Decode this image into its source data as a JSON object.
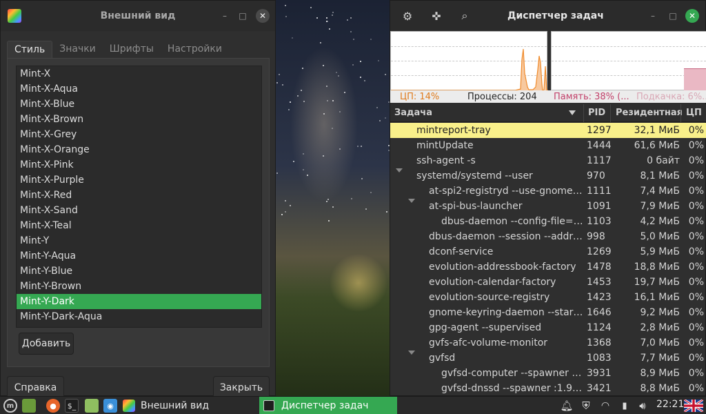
{
  "appearance": {
    "title": "Внешний вид",
    "tabs": [
      {
        "label": "Стиль",
        "active": true
      },
      {
        "label": "Значки",
        "active": false
      },
      {
        "label": "Шрифты",
        "active": false
      },
      {
        "label": "Настройки",
        "active": false
      }
    ],
    "themes": [
      "Mint-X",
      "Mint-X-Aqua",
      "Mint-X-Blue",
      "Mint-X-Brown",
      "Mint-X-Grey",
      "Mint-X-Orange",
      "Mint-X-Pink",
      "Mint-X-Purple",
      "Mint-X-Red",
      "Mint-X-Sand",
      "Mint-X-Teal",
      "Mint-Y",
      "Mint-Y-Aqua",
      "Mint-Y-Blue",
      "Mint-Y-Brown",
      "Mint-Y-Dark",
      "Mint-Y-Dark-Aqua"
    ],
    "selected_theme": "Mint-Y-Dark",
    "add_label": "Добавить",
    "help_label": "Справка",
    "close_label": "Закрыть"
  },
  "taskmgr": {
    "title": "Диспетчер задач",
    "stats": {
      "cpu": "ЦП: 14%",
      "processes": "Процессы: 204",
      "memory": "Память: 38% (...",
      "swap": "Подкачка: 6%..."
    },
    "columns": {
      "task": "Задача",
      "pid": "PID",
      "resident": "Резидентная",
      "cpu": "ЦП"
    },
    "rows": [
      {
        "name": "mintreport-tray",
        "pid": "1297",
        "res": "32,1 МиБ",
        "cpu": "0%",
        "indent": 1,
        "expander": false,
        "highlight": true
      },
      {
        "name": "mintUpdate",
        "pid": "1444",
        "res": "61,6 МиБ",
        "cpu": "0%",
        "indent": 1,
        "expander": false,
        "highlight": false
      },
      {
        "name": "ssh-agent -s",
        "pid": "1117",
        "res": "0 байт",
        "cpu": "0%",
        "indent": 1,
        "expander": false,
        "highlight": false
      },
      {
        "name": "systemd/systemd --user",
        "pid": "970",
        "res": "8,1 МиБ",
        "cpu": "0%",
        "indent": 1,
        "expander": true,
        "highlight": false
      },
      {
        "name": "at-spi2-registryd --use-gnome-se...",
        "pid": "1111",
        "res": "7,4 МиБ",
        "cpu": "0%",
        "indent": 2,
        "expander": false,
        "highlight": false
      },
      {
        "name": "at-spi-bus-launcher",
        "pid": "1091",
        "res": "7,9 МиБ",
        "cpu": "0%",
        "indent": 2,
        "expander": true,
        "highlight": false
      },
      {
        "name": "dbus-daemon --config-file=/us...",
        "pid": "1103",
        "res": "4,2 МиБ",
        "cpu": "0%",
        "indent": 3,
        "expander": false,
        "highlight": false
      },
      {
        "name": "dbus-daemon --session --address...",
        "pid": "998",
        "res": "5,0 МиБ",
        "cpu": "0%",
        "indent": 2,
        "expander": false,
        "highlight": false
      },
      {
        "name": "dconf-service",
        "pid": "1269",
        "res": "5,9 МиБ",
        "cpu": "0%",
        "indent": 2,
        "expander": false,
        "highlight": false
      },
      {
        "name": "evolution-addressbook-factory",
        "pid": "1478",
        "res": "18,8 МиБ",
        "cpu": "0%",
        "indent": 2,
        "expander": false,
        "highlight": false
      },
      {
        "name": "evolution-calendar-factory",
        "pid": "1453",
        "res": "19,7 МиБ",
        "cpu": "0%",
        "indent": 2,
        "expander": false,
        "highlight": false
      },
      {
        "name": "evolution-source-registry",
        "pid": "1423",
        "res": "16,1 МиБ",
        "cpu": "0%",
        "indent": 2,
        "expander": false,
        "highlight": false
      },
      {
        "name": "gnome-keyring-daemon --start --f...",
        "pid": "1646",
        "res": "9,2 МиБ",
        "cpu": "0%",
        "indent": 2,
        "expander": false,
        "highlight": false
      },
      {
        "name": "gpg-agent --supervised",
        "pid": "1124",
        "res": "2,8 МиБ",
        "cpu": "0%",
        "indent": 2,
        "expander": false,
        "highlight": false
      },
      {
        "name": "gvfs-afc-volume-monitor",
        "pid": "1368",
        "res": "7,0 МиБ",
        "cpu": "0%",
        "indent": 2,
        "expander": false,
        "highlight": false
      },
      {
        "name": "gvfsd",
        "pid": "1083",
        "res": "7,7 МиБ",
        "cpu": "0%",
        "indent": 2,
        "expander": true,
        "highlight": false
      },
      {
        "name": "gvfsd-computer --spawner :1.9...",
        "pid": "3931",
        "res": "8,9 МиБ",
        "cpu": "0%",
        "indent": 3,
        "expander": false,
        "highlight": false
      },
      {
        "name": "gvfsd-dnssd --spawner :1.9 /or...",
        "pid": "3421",
        "res": "8,8 МиБ",
        "cpu": "0%",
        "indent": 3,
        "expander": false,
        "highlight": false
      }
    ]
  },
  "taskbar": {
    "tasks": [
      {
        "label": "Внешний вид",
        "active": false
      },
      {
        "label": "Диспетчер задач",
        "active": true
      }
    ],
    "clock": "22:21"
  },
  "colors": {
    "accent": "#35a852",
    "highlight_row": "#f9f08a",
    "cpu_graph": "#f08a2a",
    "mem_graph": "#e0a0b0"
  }
}
